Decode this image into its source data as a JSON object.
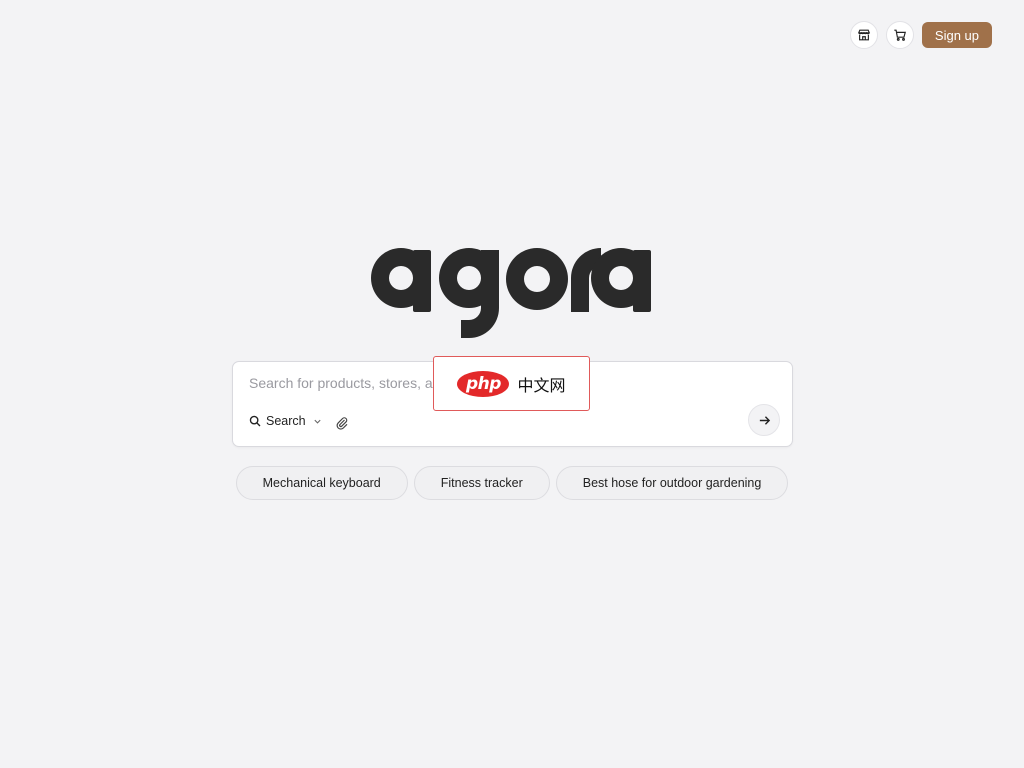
{
  "nav": {
    "store_icon": "store-icon",
    "cart_icon": "cart-icon",
    "signup_label": "Sign up",
    "signup_color": "#a0714a"
  },
  "logo": {
    "text": "agora"
  },
  "search": {
    "placeholder": "Search for products, stores, and",
    "value": "",
    "mode_label": "Search",
    "mode_icon": "search-icon",
    "attach_icon": "paperclip-icon",
    "submit_icon": "arrow-right-icon"
  },
  "overlay": {
    "php_label": "php",
    "cn_label": "中文网",
    "border_color": "#e05a5a"
  },
  "suggestions": [
    "Mechanical keyboard",
    "Fitness tracker",
    "Best hose for outdoor gardening"
  ],
  "colors": {
    "background": "#f3f3f5",
    "accent": "#a0714a"
  }
}
